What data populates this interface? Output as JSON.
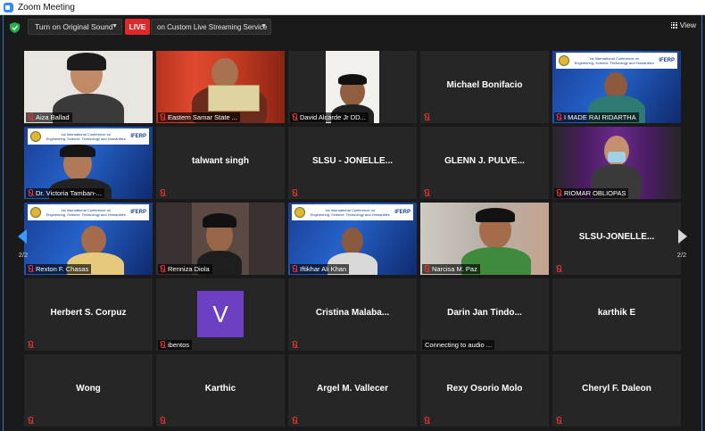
{
  "window": {
    "title": "Zoom Meeting"
  },
  "toolbar": {
    "original_sound_label": "Turn on Original Sound",
    "live_label": "LIVE",
    "stream_label": "on Custom Live Streaming Service",
    "view_label": "View"
  },
  "nav": {
    "left_page": "2/2",
    "right_page": "2/2"
  },
  "participants": [
    {
      "name": "Aiza Ballad",
      "video": true
    },
    {
      "name": "Eastern Samar State ...",
      "video": true
    },
    {
      "name": "David Alcarde Jr DD...",
      "video": true
    },
    {
      "name": "Michael Bonifacio",
      "video": false
    },
    {
      "name": "I MADE RAI RIDARTHA",
      "video": true
    },
    {
      "name": "Dr. Victoria Tamban-...",
      "video": true
    },
    {
      "name": "talwant singh",
      "video": false
    },
    {
      "name": "SLSU - JONELLE...",
      "video": false
    },
    {
      "name": "GLENN J. PULVE...",
      "video": false
    },
    {
      "name": "RIOMAR OBLIOPAS",
      "video": true
    },
    {
      "name": "Rexton F. Chasas",
      "video": true
    },
    {
      "name": "Renniza Diola",
      "video": true
    },
    {
      "name": "Iftikhar Ali Khan",
      "video": true
    },
    {
      "name": "Narcisa M. Paz",
      "video": true
    },
    {
      "name": "SLSU-JONELLE...",
      "video": false
    },
    {
      "name": "Herbert S. Corpuz",
      "video": false
    },
    {
      "name": "ibentos",
      "video": false,
      "avatar": "V"
    },
    {
      "name": "Cristina  Malaba...",
      "video": false
    },
    {
      "name": "Darin Jan Tindo...",
      "video": false,
      "status": "Connecting to audio ..."
    },
    {
      "name": "karthik E",
      "video": false
    },
    {
      "name": "Wong",
      "video": false
    },
    {
      "name": "Karthic",
      "video": false
    },
    {
      "name": "Argel M. Vallecer",
      "video": false
    },
    {
      "name": "Rexy Osorio Molo",
      "video": false
    },
    {
      "name": "Cheryl F. Daleon",
      "video": false
    }
  ],
  "colors": {
    "live": "#e02828",
    "muted": "#e03434",
    "zoom_blue": "#2d8cff",
    "avatar_purple": "#6d3fc3"
  }
}
